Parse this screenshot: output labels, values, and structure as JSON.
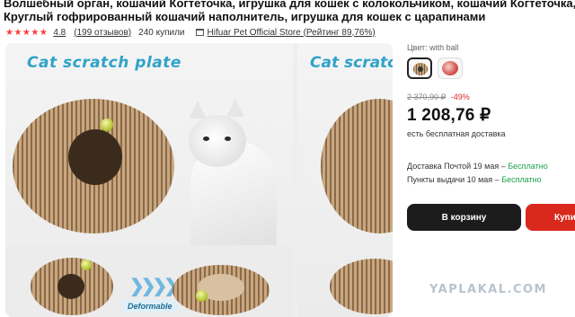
{
  "product": {
    "title_line1": "Волшебный орган, кошачий Когтеточка, игрушка для кошек с колокольчиком, кошачий Когтеточка, рама для",
    "title_line2": "Круглый гофрированный кошачий наполнитель, игрушка для кошек с царапинами"
  },
  "rating": {
    "stars": "★★★★★",
    "value": "4.8",
    "reviews": "(199 отзывов)",
    "purchases": "240 купили",
    "store": "Hifuar Pet Official Store (Рейтинг 89,76%)",
    "store_icon": "store-icon",
    "star_color": "#ff3b3b"
  },
  "gallery": {
    "main_caption": "Cat scratch plate",
    "side_caption": "Cat scratc",
    "badge": "Deformable",
    "arrows": "❯❯❯❯"
  },
  "variant": {
    "label": "Цвет: with ball",
    "options": [
      "with ball",
      "red ball"
    ],
    "selected": "with ball"
  },
  "pricing": {
    "old_price": "2 370,90 ₽",
    "discount": "-49%",
    "price": "1 208,76 ₽",
    "shipping_note": "есть бесплатная доставка",
    "discount_color": "#e02b2b"
  },
  "delivery": {
    "post_label": "Доставка Почтой 19 мая – ",
    "post_value": "Бесплатно",
    "pickup_label": "Пункты выдачи 10 мая – ",
    "pickup_value": "Бесплатно",
    "free_color": "#1aa34a"
  },
  "actions": {
    "cart": "В корзину",
    "buy": "Купить"
  },
  "watermark": "YAPLAKAL.COM"
}
